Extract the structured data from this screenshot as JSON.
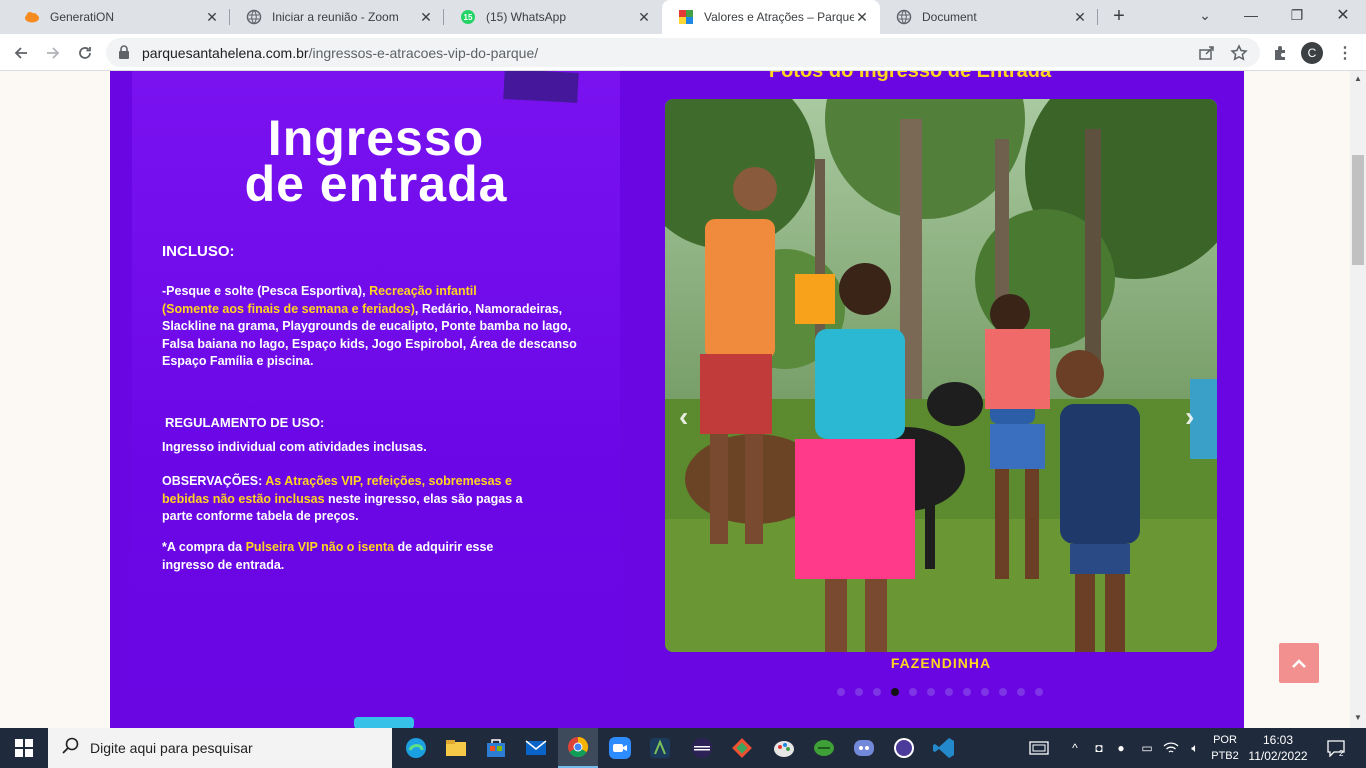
{
  "tabs": [
    {
      "title": "GeneratiON",
      "icon": "cloud-icon"
    },
    {
      "title": "Iniciar a reunião - Zoom",
      "icon": "globe-icon"
    },
    {
      "title": "(15) WhatsApp",
      "icon": "whatsapp-icon",
      "badge": "15"
    },
    {
      "title": "Valores e Atrações – Parque S",
      "icon": "site-icon"
    },
    {
      "title": "Document",
      "icon": "globe-icon"
    }
  ],
  "address": {
    "domain": "parquesantahelena.com.br",
    "path": "/ingressos-e-atracoes-vip-do-parque/"
  },
  "profile_initial": "C",
  "flyer": {
    "title_line1": "Ingresso",
    "title_line2": "de entrada",
    "incluso_heading": "INCLUSO:",
    "incluso_1": "-Pesque e solte ",
    "incluso_2": "(Pesca Esportiva)",
    "incluso_3": ", ",
    "incluso_4": "Recreação infantil",
    "incluso_5": "(Somente aos finais de semana e feriados)",
    "incluso_6": ", Redário, Namoradeiras, Slackline na grama, Playgrounds de eucalipto, Ponte bamba no lago, Falsa baiana no lago, Espaço kids, Jogo Espirobol, Área de descanso ",
    "incluso_7": "Espaço Família",
    "incluso_8": " e piscina.",
    "regulamento_heading": "REGULAMENTO DE USO:",
    "regulamento_text": "Ingresso individual com atividades inclusas.",
    "obs_label": "OBSERVAÇÕES: ",
    "obs_highlight": "As Atrações VIP, refeições, sobremesas e bebidas não estão inclusas",
    "obs_rest": " neste ingresso, elas são pagas a parte conforme tabela de preços.",
    "compra_1": "*A compra da ",
    "compra_2": "Pulseira VIP não o isenta",
    "compra_3": " de adquirir esse ingresso de entrada."
  },
  "gallery": {
    "title": "Fotos do Ingresso de Entrada",
    "caption": "FAZENDINHA",
    "slide_count": 12,
    "active_slide": 4
  },
  "taskbar": {
    "search_placeholder": "Digite aqui para pesquisar",
    "apps": [
      "edge-icon",
      "file-explorer-icon",
      "store-icon",
      "mail-icon",
      "chrome-icon",
      "zoom-icon",
      "android-studio-icon",
      "eclipse-icon",
      "git-icon",
      "paint-icon",
      "robo3t-icon",
      "discord-icon",
      "eclipse-ide-icon",
      "vscode-icon"
    ],
    "active_app": "chrome-icon",
    "lang_line1": "POR",
    "lang_line2": "PTB2",
    "time": "16:03",
    "date": "11/02/2022",
    "notifications": "2"
  },
  "colors": {
    "purple": "#6a06e2",
    "yellow": "#ffd51f",
    "to_top": "#f29090"
  }
}
